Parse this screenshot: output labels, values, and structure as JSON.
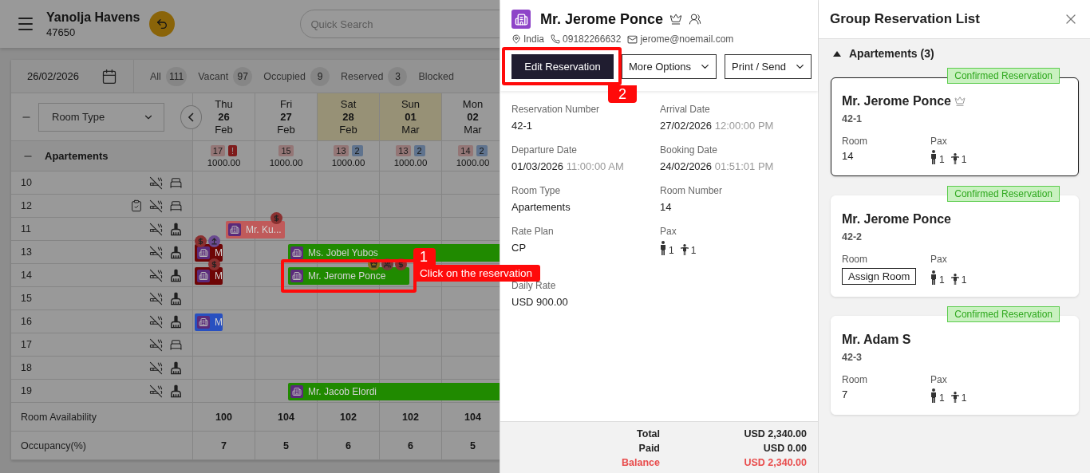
{
  "app": {
    "hotel": {
      "name": "Yanolja Havens",
      "code": "47650"
    },
    "search": {
      "placeholder": "Quick Search"
    },
    "date": "26/02/2026",
    "filters": [
      {
        "label": "All",
        "count": "111"
      },
      {
        "label": "Vacant",
        "count": "97"
      },
      {
        "label": "Occupied",
        "count": "9"
      },
      {
        "label": "Reserved",
        "count": "3"
      },
      {
        "label": "Blocked"
      }
    ],
    "room_type_select": {
      "value": "Room Type"
    },
    "days": [
      {
        "weekday": "Thu",
        "day": "26",
        "month": "Feb",
        "weekend": false
      },
      {
        "weekday": "Fri",
        "day": "27",
        "month": "Feb",
        "weekend": false
      },
      {
        "weekday": "Sat",
        "day": "28",
        "month": "Feb",
        "weekend": true
      },
      {
        "weekday": "Sun",
        "day": "01",
        "month": "Mar",
        "weekend": true
      },
      {
        "weekday": "Mon",
        "day": "02",
        "month": "Mar",
        "weekend": false
      }
    ],
    "category": {
      "name": "Apartements",
      "expanded": true,
      "stats": [
        {
          "count": "17",
          "flag": {
            "kind": "alert",
            "text": "!"
          },
          "price": "1000.00"
        },
        {
          "count": "15",
          "price": "1000.00"
        },
        {
          "count": "13",
          "flag": {
            "kind": "info",
            "text": "2"
          },
          "price": "1000.00"
        },
        {
          "count": "13",
          "flag": {
            "kind": "info",
            "text": "2"
          },
          "price": "1000.00"
        },
        {
          "count": "14",
          "flag": {
            "kind": "info",
            "text": "2"
          },
          "price": "1000.00"
        }
      ]
    },
    "rooms": [
      {
        "number": "10",
        "non_smoking": true,
        "clean": true,
        "inspected": false
      },
      {
        "number": "12",
        "non_smoking": true,
        "clean": true,
        "inspected": true
      },
      {
        "number": "11",
        "non_smoking": true,
        "clean": false,
        "inspected": false,
        "bookings": [
          {
            "guest": "Mr. Ku...",
            "color": "#c05a5a",
            "days": [
              {
                "kind": "checkin"
              },
              {
                "kind": "checkout"
              },
              {
                "kind": "none"
              },
              {
                "kind": "none"
              },
              {
                "kind": "none"
              }
            ],
            "badges": [
              {
                "kind": "payment"
              }
            ]
          }
        ]
      },
      {
        "number": "13",
        "non_smoking": true,
        "clean": false,
        "inspected": false,
        "bookings": [
          {
            "guest": "M",
            "color": "#6e0505",
            "days": [
              {
                "kind": "checkout"
              },
              {
                "kind": "none"
              },
              {
                "kind": "none"
              },
              {
                "kind": "none"
              },
              {
                "kind": "none"
              }
            ],
            "badges": [
              {
                "kind": "payment"
              },
              {
                "kind": "upload"
              }
            ]
          },
          {
            "guest": "Ms. Jobel Yubos",
            "color": "#208a00",
            "days": [
              {
                "kind": "none"
              },
              {
                "kind": "checkin"
              },
              {
                "kind": "stay"
              },
              {
                "kind": "stay"
              },
              {
                "kind": "stay"
              }
            ]
          }
        ]
      },
      {
        "number": "14",
        "non_smoking": true,
        "clean": false,
        "inspected": false,
        "bookings": [
          {
            "guest": "M",
            "color": "#6e0505",
            "days": [
              {
                "kind": "checkout"
              },
              {
                "kind": "none"
              },
              {
                "kind": "none"
              },
              {
                "kind": "none"
              },
              {
                "kind": "none"
              }
            ],
            "badges": [
              {
                "kind": "payment"
              }
            ]
          },
          {
            "guest": "Mr. Jerome Ponce",
            "color": "#208a00",
            "days": [
              {
                "kind": "none"
              },
              {
                "kind": "checkin"
              },
              {
                "kind": "stay"
              },
              {
                "kind": "checkout"
              },
              {
                "kind": "none"
              }
            ],
            "badges": [
              {
                "kind": "vip"
              },
              {
                "kind": "group"
              },
              {
                "kind": "payment"
              }
            ],
            "annotation": {
              "number": "1",
              "text": "Click on the reservation"
            }
          }
        ]
      },
      {
        "number": "15",
        "non_smoking": true,
        "clean": false,
        "inspected": false
      },
      {
        "number": "16",
        "non_smoking": true,
        "clean": false,
        "inspected": false,
        "bookings": [
          {
            "guest": "M",
            "color": "#2850c0",
            "days": [
              {
                "kind": "checkout"
              },
              {
                "kind": "none"
              },
              {
                "kind": "none"
              },
              {
                "kind": "none"
              },
              {
                "kind": "none"
              }
            ]
          }
        ]
      },
      {
        "number": "17",
        "non_smoking": true,
        "clean": true,
        "inspected": false
      },
      {
        "number": "18",
        "non_smoking": true,
        "clean": false,
        "inspected": false
      },
      {
        "number": "19",
        "non_smoking": true,
        "clean": false,
        "inspected": false,
        "bookings": [
          {
            "guest": "Mr. Jacob Elordi",
            "color": "#208a00",
            "days": [
              {
                "kind": "none"
              },
              {
                "kind": "checkin"
              },
              {
                "kind": "stay"
              },
              {
                "kind": "stay"
              },
              {
                "kind": "stay"
              }
            ]
          }
        ]
      }
    ],
    "summary": [
      {
        "label": "Room Availability",
        "values": [
          "100",
          "104",
          "102",
          "102",
          "104"
        ]
      },
      {
        "label": "Occupancy(%)",
        "values": [
          "7",
          "5",
          "6",
          "6",
          "5"
        ]
      }
    ]
  },
  "reservation": {
    "guest": "Mr. Jerome Ponce",
    "vip": true,
    "group": true,
    "country": "India",
    "phone": "09182266632",
    "email": "jerome@noemail.com",
    "actions": [
      {
        "label": "Edit Reservation",
        "kind": "primary",
        "annotation": {
          "number": "2"
        }
      },
      {
        "label": "More Options",
        "kind": "dropdown"
      },
      {
        "label": "Print / Send",
        "kind": "dropdown"
      }
    ],
    "fields": [
      {
        "kind": "text",
        "label": "Reservation Number",
        "value": "42-1"
      },
      {
        "kind": "datetime",
        "label": "Arrival Date",
        "value": "27/02/2026",
        "time": "12:00:00 PM"
      },
      {
        "kind": "datetime",
        "label": "Departure Date",
        "value": "01/03/2026",
        "time": "11:00:00 AM"
      },
      {
        "kind": "datetime",
        "label": "Booking Date",
        "value": "24/02/2026",
        "time": "01:51:01 PM"
      },
      {
        "kind": "text",
        "label": "Room Type",
        "value": "Apartements"
      },
      {
        "kind": "text",
        "label": "Room Number",
        "value": "14"
      },
      {
        "kind": "text",
        "label": "Rate Plan",
        "value": "CP"
      },
      {
        "kind": "pax",
        "label": "Pax",
        "adults": "1",
        "children": "1"
      },
      {
        "kind": "text",
        "label": "Daily Rate",
        "value": "USD 900.00"
      }
    ],
    "totals": [
      {
        "label": "Total",
        "value": "USD 2,340.00",
        "kind": "normal"
      },
      {
        "label": "Paid",
        "value": "USD 0.00",
        "kind": "normal"
      },
      {
        "label": "Balance",
        "value": "USD 2,340.00",
        "kind": "due"
      }
    ]
  },
  "group_list": {
    "title": "Group Reservation List",
    "section": {
      "name": "Apartements (3)",
      "expanded": true
    },
    "cards": [
      {
        "status": "Confirmed Reservation",
        "guest": "Mr. Jerome Ponce",
        "vip": true,
        "number": "42-1",
        "room_label": "Room",
        "room": "14",
        "pax_label": "Pax",
        "adults": "1",
        "children": "1",
        "selected": true
      },
      {
        "status": "Confirmed Reservation",
        "guest": "Mr. Jerome Ponce",
        "vip": false,
        "number": "42-2",
        "room_label": "Room",
        "assign_label": "Assign Room",
        "pax_label": "Pax",
        "adults": "1",
        "children": "1",
        "selected": false
      },
      {
        "status": "Confirmed Reservation",
        "guest": "Mr. Adam S",
        "vip": false,
        "number": "42-3",
        "room_label": "Room",
        "room": "7",
        "pax_label": "Pax",
        "adults": "1",
        "children": "1",
        "selected": false
      }
    ]
  }
}
